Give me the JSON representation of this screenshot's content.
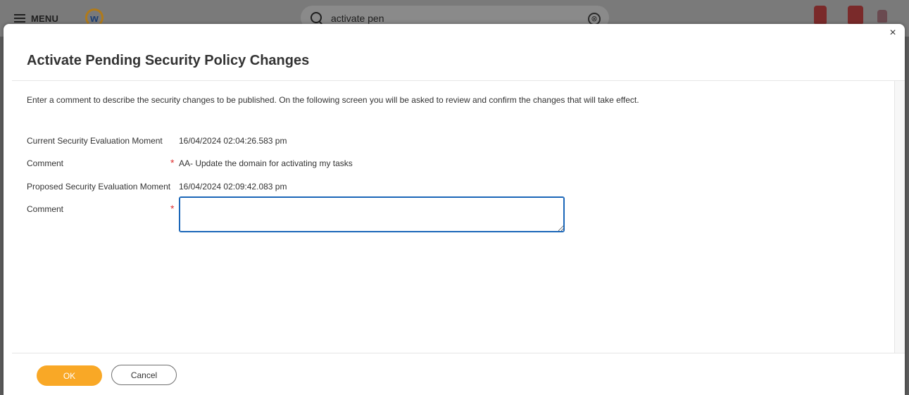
{
  "app": {
    "menu_label": "MENU",
    "logo_letter": "w",
    "search": {
      "value": "activate pen",
      "clear_symbol": "⊗"
    }
  },
  "dialog": {
    "title": "Activate Pending Security Policy Changes",
    "close_symbol": "×",
    "instructions": "Enter a comment to describe the security changes to be published. On the following screen you will be asked to review and confirm the changes that will take effect.",
    "fields": [
      {
        "label": "Current Security Evaluation Moment",
        "value": "16/04/2024 02:04:26.583 pm",
        "required": false
      },
      {
        "label": "Comment",
        "value": "AA- Update the domain for activating my tasks",
        "required": true
      },
      {
        "label": "Proposed Security Evaluation Moment",
        "value": "16/04/2024 02:09:42.083 pm",
        "required": false
      },
      {
        "label": "Comment",
        "value": "",
        "required": true
      }
    ],
    "required_marker": "*",
    "ok_label": "OK",
    "cancel_label": "Cancel"
  },
  "colors": {
    "primary_button": "#f9a826",
    "required": "#de2d2d",
    "focus_border": "#1a66b8"
  }
}
